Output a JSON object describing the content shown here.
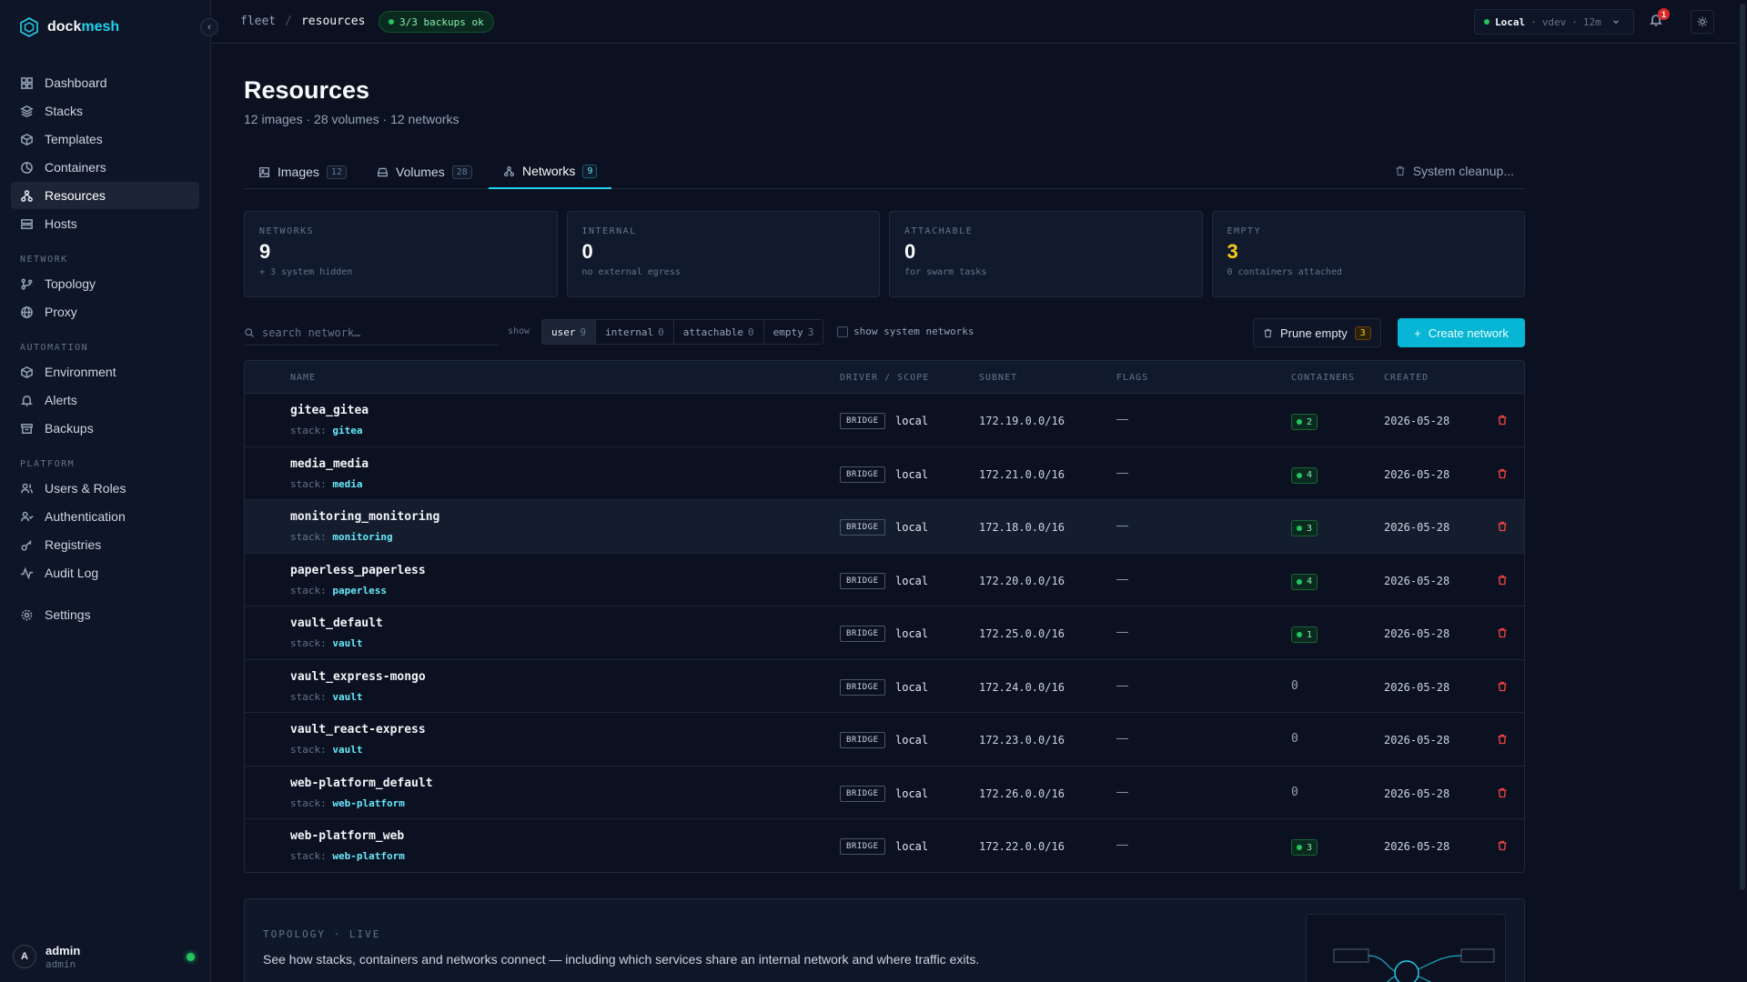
{
  "app": {
    "brand_a": "dock",
    "brand_b": "mesh"
  },
  "sidebar": {
    "items": [
      {
        "label": "Dashboard",
        "icon": "dashboard-icon"
      },
      {
        "label": "Stacks",
        "icon": "layers-icon"
      },
      {
        "label": "Templates",
        "icon": "template-icon"
      },
      {
        "label": "Containers",
        "icon": "box-icon"
      },
      {
        "label": "Resources",
        "icon": "resources-icon",
        "active": true
      },
      {
        "label": "Hosts",
        "icon": "server-icon"
      }
    ],
    "sections": {
      "network": {
        "title": "NETWORK",
        "items": [
          {
            "label": "Topology"
          },
          {
            "label": "Proxy"
          }
        ]
      },
      "automation": {
        "title": "AUTOMATION",
        "items": [
          {
            "label": "Environment"
          },
          {
            "label": "Alerts"
          },
          {
            "label": "Backups"
          }
        ]
      },
      "platform": {
        "title": "PLATFORM",
        "items": [
          {
            "label": "Users & Roles"
          },
          {
            "label": "Authentication"
          },
          {
            "label": "Registries"
          },
          {
            "label": "Audit Log"
          }
        ]
      }
    },
    "settings": "Settings",
    "user": {
      "initial": "A",
      "name": "admin",
      "role": "admin"
    }
  },
  "topbar": {
    "breadcrumb": [
      "fleet",
      "/",
      "resources"
    ],
    "backup_status": "3/3 backups ok",
    "host": {
      "name": "Local",
      "sep1": "·",
      "env": "vdev",
      "sep2": "·",
      "age": "12m"
    },
    "notifications": "1"
  },
  "page": {
    "title": "Resources",
    "subtitle": "12 images · 28 volumes · 12 networks"
  },
  "tabs": [
    {
      "label": "Images",
      "count": "12"
    },
    {
      "label": "Volumes",
      "count": "28"
    },
    {
      "label": "Networks",
      "count": "9",
      "active": true
    }
  ],
  "cleanup_label": "System cleanup...",
  "stats": [
    {
      "label": "NETWORKS",
      "value": "9",
      "note": "+ 3 system hidden"
    },
    {
      "label": "INTERNAL",
      "value": "0",
      "note": "no external egress"
    },
    {
      "label": "ATTACHABLE",
      "value": "0",
      "note": "for swarm tasks"
    },
    {
      "label": "EMPTY",
      "value": "3",
      "note": "0 containers attached"
    }
  ],
  "filters": {
    "search_placeholder": "search network…",
    "show_label": "show",
    "segments": [
      {
        "label": "user",
        "count": "9"
      },
      {
        "label": "internal",
        "count": "0"
      },
      {
        "label": "attachable",
        "count": "0"
      },
      {
        "label": "empty",
        "count": "3"
      }
    ],
    "system_toggle": "show system networks",
    "prune_label": "Prune empty",
    "prune_count": "3",
    "create_label": "Create network"
  },
  "table": {
    "headers": {
      "name": "NAME",
      "driver": "DRIVER / SCOPE",
      "subnet": "SUBNET",
      "flags": "FLAGS",
      "containers": "CONTAINERS",
      "created": "CREATED"
    },
    "stack_prefix": "stack:",
    "rows": [
      {
        "name": "gitea_gitea",
        "stack": "gitea",
        "driver": "BRIDGE",
        "scope": "local",
        "subnet": "172.19.0.0/16",
        "flags": "—",
        "containers": "2",
        "created": "2026-05-28"
      },
      {
        "name": "media_media",
        "stack": "media",
        "driver": "BRIDGE",
        "scope": "local",
        "subnet": "172.21.0.0/16",
        "flags": "—",
        "containers": "4",
        "created": "2026-05-28"
      },
      {
        "name": "monitoring_monitoring",
        "stack": "monitoring",
        "driver": "BRIDGE",
        "scope": "local",
        "subnet": "172.18.0.0/16",
        "flags": "—",
        "containers": "3",
        "created": "2026-05-28"
      },
      {
        "name": "paperless_paperless",
        "stack": "paperless",
        "driver": "BRIDGE",
        "scope": "local",
        "subnet": "172.20.0.0/16",
        "flags": "—",
        "containers": "4",
        "created": "2026-05-28"
      },
      {
        "name": "vault_default",
        "stack": "vault",
        "driver": "BRIDGE",
        "scope": "local",
        "subnet": "172.25.0.0/16",
        "flags": "—",
        "containers": "1",
        "created": "2026-05-28"
      },
      {
        "name": "vault_express-mongo",
        "stack": "vault",
        "driver": "BRIDGE",
        "scope": "local",
        "subnet": "172.24.0.0/16",
        "flags": "—",
        "containers": "0",
        "created": "2026-05-28"
      },
      {
        "name": "vault_react-express",
        "stack": "vault",
        "driver": "BRIDGE",
        "scope": "local",
        "subnet": "172.23.0.0/16",
        "flags": "—",
        "containers": "0",
        "created": "2026-05-28"
      },
      {
        "name": "web-platform_default",
        "stack": "web-platform",
        "driver": "BRIDGE",
        "scope": "local",
        "subnet": "172.26.0.0/16",
        "flags": "—",
        "containers": "0",
        "created": "2026-05-28"
      },
      {
        "name": "web-platform_web",
        "stack": "web-platform",
        "driver": "BRIDGE",
        "scope": "local",
        "subnet": "172.22.0.0/16",
        "flags": "—",
        "containers": "3",
        "created": "2026-05-28"
      }
    ]
  },
  "topology": {
    "label": "TOPOLOGY · LIVE",
    "description": "See how stacks, containers and networks connect — including which services share an internal network and where traffic exits."
  },
  "colors": {
    "accent": "#22d3ee",
    "ok": "#22c55e",
    "warn": "#facc15",
    "danger": "#ef4444",
    "bg": "#0b1120"
  }
}
